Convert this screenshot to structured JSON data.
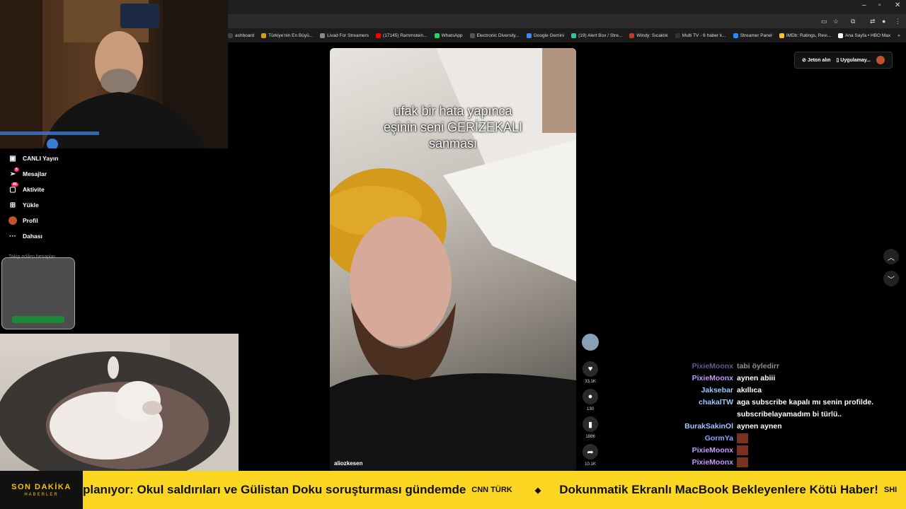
{
  "browser": {
    "bookmarks": [
      {
        "label": "ashboard",
        "color": "#444444"
      },
      {
        "label": "Türkiye'nin En Büyü...",
        "color": "#d4a017"
      },
      {
        "label": "Livad For Streamers",
        "color": "#888888"
      },
      {
        "label": "(17145) Rammstein...",
        "color": "#ff0000"
      },
      {
        "label": "WhatsApp",
        "color": "#25d366"
      },
      {
        "label": "Electronic Diversity...",
        "color": "#555555"
      },
      {
        "label": "Google Gemini",
        "color": "#4285f4"
      },
      {
        "label": "(19) Alert Box / Stre...",
        "color": "#31c3a2"
      },
      {
        "label": "Windy: Sıcaklık",
        "color": "#c0392b"
      },
      {
        "label": "Multi TV - 6 haber k...",
        "color": "#333333"
      },
      {
        "label": "Streamer Panel",
        "color": "#1e90ff"
      },
      {
        "label": "IMDb: Ratings, Revi...",
        "color": "#f5c518"
      },
      {
        "label": "Ana Sayfa • HBO Max",
        "color": "#ffffff"
      }
    ],
    "all_bookmarks": "Tüm Yer İşaretleri"
  },
  "sidebar": {
    "items": [
      {
        "label": "CANLI Yayın",
        "icon": "live-icon"
      },
      {
        "label": "Mesajlar",
        "icon": "send-icon",
        "badge": "5"
      },
      {
        "label": "Aktivite",
        "icon": "activity-icon",
        "badge": "40"
      },
      {
        "label": "Yükle",
        "icon": "upload-icon"
      },
      {
        "label": "Profil",
        "icon": "avatar-icon"
      },
      {
        "label": "Dahası",
        "icon": "more-icon"
      }
    ],
    "following_header": "Takip edilen hesaplar"
  },
  "topbar": {
    "coins": "Jeton alın",
    "app": "Uygulamay..."
  },
  "video": {
    "overlay_lines": [
      "ufak bir hata yapınca",
      "eşinin seni GERİZEKALI",
      "sanması"
    ],
    "author": "aliozkesen"
  },
  "actions": {
    "likes": "33.1K",
    "comments": "130",
    "saves": "1886",
    "shares": "10.1K"
  },
  "chat": [
    {
      "name": "PixieMoonx",
      "color": "#c39bff",
      "msg": "tabi öyledirr",
      "faded": true
    },
    {
      "name": "PixieMoonx",
      "color": "#c39bff",
      "msg": "aynen abiii"
    },
    {
      "name": "Jaksebar",
      "color": "#9ec7ff",
      "msg": "akıllıca"
    },
    {
      "name": "chakalTW",
      "color": "#9ec7ff",
      "msg": "aga subscribe kapalı mı senin profilde. subscribelayamadım bi türlü.."
    },
    {
      "name": "BurakSakinOl",
      "color": "#9ec7ff",
      "msg": "aynen aynen"
    },
    {
      "name": "GormYa",
      "color": "#7fa8ff",
      "msg": "",
      "emote": true
    },
    {
      "name": "PixieMoonx",
      "color": "#c39bff",
      "msg": "",
      "emote": true
    },
    {
      "name": "PixieMoonx",
      "color": "#c39bff",
      "msg": "",
      "emote": true
    }
  ],
  "ticker": {
    "brand": "SON DAKİKA",
    "brand_sub": "HABERLER",
    "headline1": "planıyor: Okul saldırıları ve Gülistan Doku soruşturması gündemde",
    "source1": "CNN TÜRK",
    "headline2": "Dokunmatik Ekranlı MacBook Bekleyenlere Kötü Haber!",
    "source2": "SHI"
  }
}
